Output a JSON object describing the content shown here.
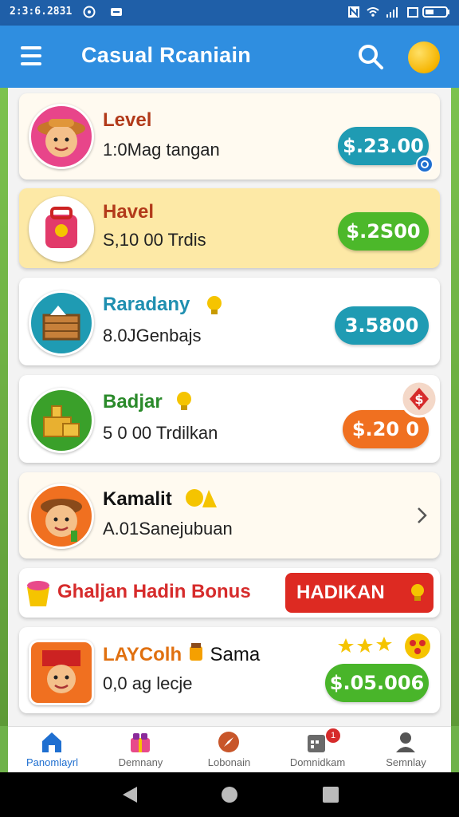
{
  "status_bar": {
    "time": "2:3:6.2831",
    "icons": [
      "whatsapp-icon",
      "message-icon",
      "nfc-icon",
      "wifi-icon",
      "signal-icon",
      "battery-icon"
    ]
  },
  "app_bar": {
    "title": "Casual Rcaniain",
    "icons": [
      "menu-icon",
      "search-icon",
      "coin-icon"
    ]
  },
  "cards": [
    {
      "title": "Level",
      "subtitle": "1:0Mag tangan",
      "amount": "$.23.00",
      "title_color": "#b23a1a",
      "pill_color": "#1f9bb3"
    },
    {
      "title": "Havel",
      "subtitle": "S,10 00 Trdis",
      "amount": "$.2S00",
      "title_color": "#b23a1a",
      "pill_color": "#4cb82a"
    },
    {
      "title": "Raradany",
      "subtitle": "8.0JGenbajs",
      "amount": "3.5800",
      "title_color": "#1f8fb0",
      "pill_color": "#1f9bb3"
    },
    {
      "title": "Badjar",
      "subtitle": "5 0 00 Trdilkan",
      "amount": "$.20 0",
      "title_color": "#2a8a2a",
      "pill_color": "#f07020"
    },
    {
      "title": "Kamalit",
      "subtitle": "A.01Sanejubuan",
      "amount": "",
      "title_color": "#111111",
      "pill_color": ""
    }
  ],
  "bonus": {
    "text": "Ghaljan Hadin Bonus",
    "button": "HADIKAN"
  },
  "last_card": {
    "title": "LAYColh",
    "title_suffix": "Sama",
    "subtitle": "0,0  ag lecje",
    "amount": "$.05.006",
    "pill_color": "#49b52a"
  },
  "nav": [
    {
      "label": "Panomlayrl",
      "icon": "home-icon",
      "active": true
    },
    {
      "label": "Demnany",
      "icon": "gift-icon",
      "active": false
    },
    {
      "label": "Lobonain",
      "icon": "compass-icon",
      "active": false
    },
    {
      "label": "Domnidkam",
      "icon": "calendar-icon",
      "badge": "1",
      "active": false
    },
    {
      "label": "Semnlay",
      "icon": "profile-icon",
      "active": false
    }
  ],
  "colors": {
    "accent": "#2f8ee0",
    "active_nav": "#1f6fd0"
  }
}
